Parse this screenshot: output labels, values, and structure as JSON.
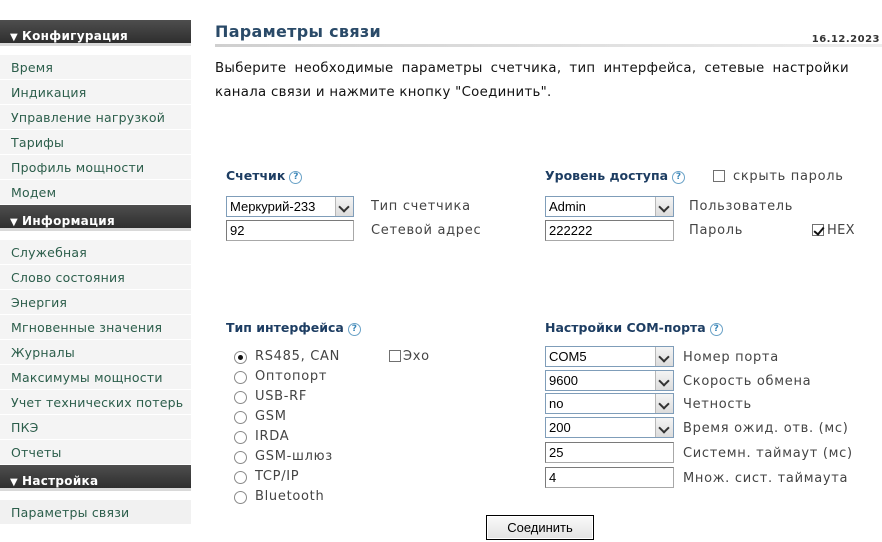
{
  "sidebar": {
    "sections": [
      {
        "title": "Конфигурация",
        "items": [
          "Время",
          "Индикация",
          "Управление нагрузкой",
          "Тарифы",
          "Профиль мощности",
          "Модем"
        ]
      },
      {
        "title": "Информация",
        "items": [
          "Служебная",
          "Слово состояния",
          "Энергия",
          "Мгновенные значения",
          "Журналы",
          "Максимумы мощности",
          "Учет технических потерь",
          "ПКЭ",
          "Отчеты"
        ]
      },
      {
        "title": "Настройка",
        "items": [
          "Параметры связи"
        ]
      }
    ]
  },
  "page": {
    "title": "Параметры связи",
    "date": "16.12.2023",
    "intro": "Выберите необходимые параметры счетчика, тип интерфейса, сетевые настройки канала связи и нажмите кнопку \"Соединить\"."
  },
  "meter": {
    "title": "Счетчик",
    "type_value": "Меркурий-233",
    "type_label": "Тип счетчика",
    "address_value": "92",
    "address_label": "Сетевой адрес"
  },
  "access": {
    "title": "Уровень доступа",
    "hide_password_label": "скрыть пароль",
    "hide_password_checked": false,
    "user_value": "Admin",
    "user_label": "Пользователь",
    "password_value": "222222",
    "password_label": "Пароль",
    "hex_label": "HEX",
    "hex_checked": true
  },
  "interface": {
    "title": "Тип интерфейса",
    "echo_label": "Эхо",
    "echo_checked": false,
    "options": [
      "RS485, CAN",
      "Оптопорт",
      "USB-RF",
      "GSM",
      "IRDA",
      "GSM-шлюз",
      "TCP/IP",
      "Bluetooth"
    ],
    "selected": "RS485, CAN"
  },
  "com": {
    "title": "Настройки COM-порта",
    "port_value": "COM5",
    "port_label": "Номер порта",
    "baud_value": "9600",
    "baud_label": "Скорость обмена",
    "parity_value": "no",
    "parity_label": "Четность",
    "wait_value": "200",
    "wait_label": "Время ожид. отв. (мс)",
    "sys_timeout_value": "25",
    "sys_timeout_label": "Системн. таймаут (мс)",
    "mult_value": "4",
    "mult_label": "Множ. сист. таймаута"
  },
  "buttons": {
    "connect_label": "Соединить"
  },
  "icons": {
    "help": "help-circle-icon",
    "section": "triangle-down-icon"
  },
  "colors": {
    "sidebar_header": "#3b3b3b",
    "nav_link": "#2c5e4b",
    "title": "#2a4a68",
    "group_title": "#1d3d62"
  }
}
